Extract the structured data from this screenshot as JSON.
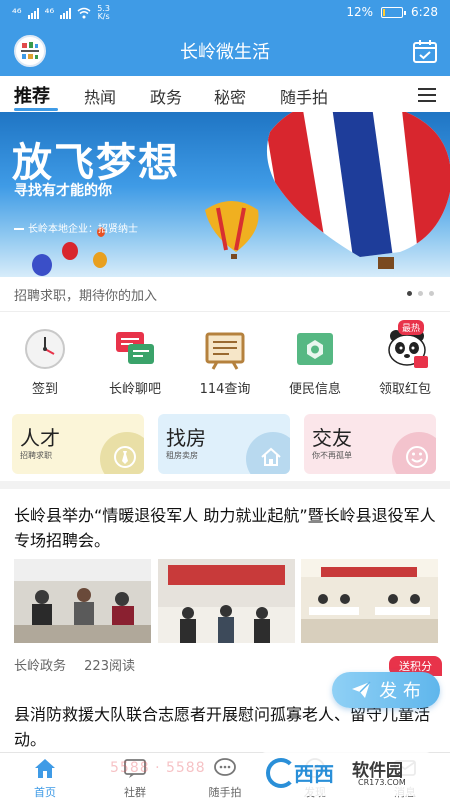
{
  "status_bar": {
    "network_1": "⁴⁶",
    "network_2": "⁴⁶",
    "speed_value": "5.3",
    "speed_unit": "K/s",
    "battery_text": "12%",
    "battery_level": 0.12,
    "time": "6:28"
  },
  "app_bar": {
    "title": "长岭微生活"
  },
  "tabs": [
    {
      "label": "推荐",
      "active": true
    },
    {
      "label": "热闻",
      "active": false
    },
    {
      "label": "政务",
      "active": false
    },
    {
      "label": "秘密",
      "active": false
    },
    {
      "label": "随手拍",
      "active": false
    }
  ],
  "banner": {
    "headline": "放飞梦想",
    "subtitle": "寻找有才能的你",
    "company_line": "长岭本地企业：招贤纳士",
    "caption": "招聘求职，期待你的加入",
    "slide_count": 3,
    "active_slide": 0
  },
  "quick_links": [
    {
      "label": "签到",
      "icon": "clock-icon"
    },
    {
      "label": "长岭聊吧",
      "icon": "chat-bubbles-icon"
    },
    {
      "label": "114查询",
      "icon": "board-icon"
    },
    {
      "label": "便民信息",
      "icon": "info-card-icon"
    },
    {
      "label": "领取红包",
      "icon": "panda-icon",
      "badge": "最热"
    }
  ],
  "cards": [
    {
      "title": "人才",
      "subtitle": "招聘求职",
      "bg": "#fbf5d8",
      "accent": "#e9dfa6",
      "icon": "tie-icon"
    },
    {
      "title": "找房",
      "subtitle": "租房卖房",
      "bg": "#dff0fb",
      "accent": "#b8d9ef",
      "icon": "house-icon"
    },
    {
      "title": "交友",
      "subtitle": "你不再孤单",
      "bg": "#fbe6ea",
      "accent": "#f3c3cd",
      "icon": "heart-face-icon"
    }
  ],
  "article": {
    "title": "长岭县举办“情暖退役军人 助力就业起航”暨长岭县退役军人专场招聘会。",
    "source": "长岭政务",
    "reads": "223阅读",
    "photo_count": 3
  },
  "article2": {
    "title": "县消防救援大队联合志愿者开展慰问孤寡老人、留守儿童活动。"
  },
  "floating": {
    "points_badge": "送积分",
    "publish_label": "发 布"
  },
  "bottom_nav": [
    {
      "label": "首页",
      "icon": "home-icon",
      "active": true
    },
    {
      "label": "社群",
      "icon": "community-icon",
      "active": false
    },
    {
      "label": "随手拍",
      "icon": "camera-chat-icon",
      "active": false
    },
    {
      "label": "发现",
      "icon": "discover-icon",
      "active": false
    },
    {
      "label": "消息",
      "icon": "message-icon",
      "active": false
    }
  ],
  "watermark": {
    "phone": "5588 · 5588",
    "brand_cn": "西西软件园",
    "brand_en": "CR173.COM"
  },
  "colors": {
    "primary": "#3f9be6",
    "hot_red": "#e8334a"
  }
}
